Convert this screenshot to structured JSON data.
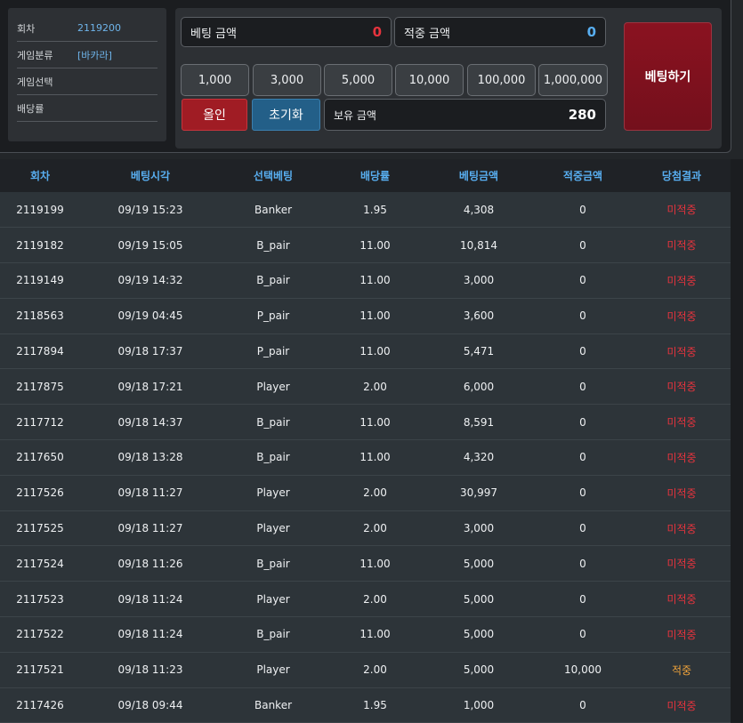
{
  "info": {
    "round_label": "회차",
    "round_value": "2119200",
    "game_type_label": "게임분류",
    "game_type_value": "[바카라]",
    "game_select_label": "게임선택",
    "odds_label": "배당률"
  },
  "bet": {
    "bet_amount_label": "베팅 금액",
    "bet_amount_value": "0",
    "win_amount_label": "적중 금액",
    "win_amount_value": "0",
    "chips": [
      "1,000",
      "3,000",
      "5,000",
      "10,000",
      "100,000",
      "1,000,000"
    ],
    "all_in_label": "올인",
    "reset_label": "초기화",
    "balance_label": "보유 금액",
    "balance_value": "280",
    "submit_label": "베팅하기"
  },
  "colors": {
    "miss": "#e6333d",
    "hit": "#f0a33a",
    "header": "#58aef0",
    "bet_amount": "#e6333d",
    "win_amount": "#58aef0"
  },
  "table": {
    "headers": [
      "회차",
      "베팅시각",
      "선택베팅",
      "배당률",
      "베팅금액",
      "적중금액",
      "당첨결과"
    ],
    "rows": [
      [
        "2119199",
        "09/19 15:23",
        "Banker",
        "1.95",
        "4,308",
        "0",
        "미적중"
      ],
      [
        "2119182",
        "09/19 15:05",
        "B_pair",
        "11.00",
        "10,814",
        "0",
        "미적중"
      ],
      [
        "2119149",
        "09/19 14:32",
        "B_pair",
        "11.00",
        "3,000",
        "0",
        "미적중"
      ],
      [
        "2118563",
        "09/19 04:45",
        "P_pair",
        "11.00",
        "3,600",
        "0",
        "미적중"
      ],
      [
        "2117894",
        "09/18 17:37",
        "P_pair",
        "11.00",
        "5,471",
        "0",
        "미적중"
      ],
      [
        "2117875",
        "09/18 17:21",
        "Player",
        "2.00",
        "6,000",
        "0",
        "미적중"
      ],
      [
        "2117712",
        "09/18 14:37",
        "B_pair",
        "11.00",
        "8,591",
        "0",
        "미적중"
      ],
      [
        "2117650",
        "09/18 13:28",
        "B_pair",
        "11.00",
        "4,320",
        "0",
        "미적중"
      ],
      [
        "2117526",
        "09/18 11:27",
        "Player",
        "2.00",
        "30,997",
        "0",
        "미적중"
      ],
      [
        "2117525",
        "09/18 11:27",
        "Player",
        "2.00",
        "3,000",
        "0",
        "미적중"
      ],
      [
        "2117524",
        "09/18 11:26",
        "B_pair",
        "11.00",
        "5,000",
        "0",
        "미적중"
      ],
      [
        "2117523",
        "09/18 11:24",
        "Player",
        "2.00",
        "5,000",
        "0",
        "미적중"
      ],
      [
        "2117522",
        "09/18 11:24",
        "B_pair",
        "11.00",
        "5,000",
        "0",
        "미적중"
      ],
      [
        "2117521",
        "09/18 11:23",
        "Player",
        "2.00",
        "5,000",
        "10,000",
        "적중"
      ],
      [
        "2117426",
        "09/18 09:44",
        "Banker",
        "1.95",
        "1,000",
        "0",
        "미적중"
      ]
    ]
  }
}
